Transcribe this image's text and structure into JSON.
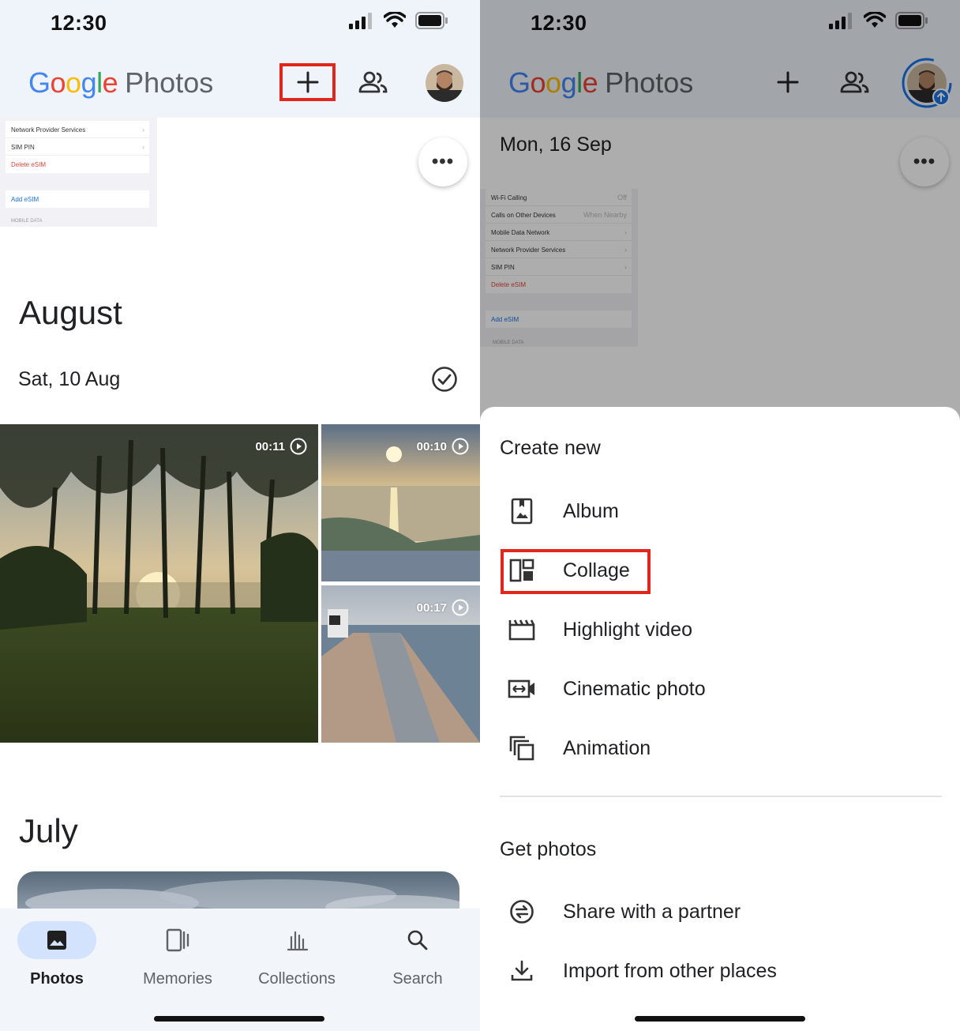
{
  "left": {
    "status": {
      "time": "12:30"
    },
    "header": {
      "logo_google": "Google",
      "logo_photos": "Photos"
    },
    "top_thumb": {
      "rows": [
        "Network Provider Services",
        "SIM PIN",
        "Delete eSIM"
      ],
      "add": "Add eSIM",
      "section": "MOBILE DATA"
    },
    "more": "•••",
    "august": {
      "title": "August",
      "date": "Sat, 10 Aug"
    },
    "videos": [
      "00:11",
      "00:10",
      "00:17"
    ],
    "july": {
      "title": "July"
    },
    "nav": {
      "photos": "Photos",
      "memories": "Memories",
      "collections": "Collections",
      "search": "Search"
    }
  },
  "right": {
    "status": {
      "time": "12:30"
    },
    "header": {
      "logo_google": "Google",
      "logo_photos": "Photos"
    },
    "date": "Mon, 16 Sep",
    "more": "•••",
    "thumb": {
      "rows": [
        {
          "label": "Wi-Fi Calling",
          "value": "Off"
        },
        {
          "label": "Calls on Other Devices",
          "value": "When Nearby"
        },
        {
          "label": "Mobile Data Network",
          "value": ""
        },
        {
          "label": "Network Provider Services",
          "value": ""
        },
        {
          "label": "SIM PIN",
          "value": ""
        },
        {
          "label": "Delete eSIM",
          "value": ""
        }
      ],
      "add": "Add eSIM",
      "section": "MOBILE DATA"
    },
    "sheet": {
      "create_title": "Create new",
      "create_items": [
        "Album",
        "Collage",
        "Highlight video",
        "Cinematic photo",
        "Animation"
      ],
      "get_title": "Get photos",
      "get_items": [
        "Share with a partner",
        "Import from other places"
      ]
    }
  },
  "colors": {
    "highlight": "#e3261b",
    "accent": "#1a73e8",
    "nav_pill": "#d3e3fd"
  }
}
